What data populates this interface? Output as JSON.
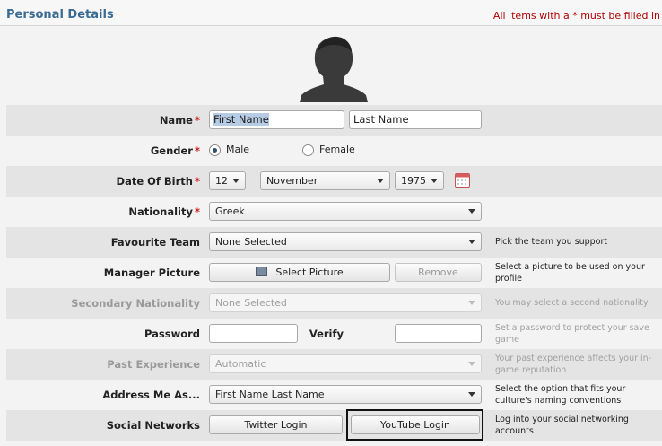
{
  "header": {
    "title": "Personal Details",
    "required_note": "All items with a * must be filled in",
    "required_marker": "*"
  },
  "fields": {
    "name": {
      "label": "Name",
      "first_value": "First Name",
      "last_value": "Last Name"
    },
    "gender": {
      "label": "Gender",
      "options": [
        "Male",
        "Female"
      ],
      "selected": "Male"
    },
    "dob": {
      "label": "Date Of Birth",
      "day": "12",
      "month": "November",
      "year": "1975"
    },
    "nationality": {
      "label": "Nationality",
      "value": "Greek"
    },
    "favourite_team": {
      "label": "Favourite Team",
      "value": "None Selected",
      "help": "Pick the team you support"
    },
    "manager_picture": {
      "label": "Manager Picture",
      "select_label": "Select Picture",
      "remove_label": "Remove",
      "help": "Select a picture to be used on your profile"
    },
    "secondary_nationality": {
      "label": "Secondary Nationality",
      "value": "None Selected",
      "help": "You may select a second nationality"
    },
    "password": {
      "label": "Password",
      "verify_label": "Verify",
      "value": "",
      "verify_value": "",
      "help": "Set a password to protect your save game"
    },
    "past_experience": {
      "label": "Past Experience",
      "value": "Automatic",
      "help": "Your past experience affects your in-game reputation"
    },
    "address_me_as": {
      "label": "Address Me As...",
      "value": "First Name Last Name",
      "help": "Select the option that fits your culture's naming conventions"
    },
    "social_networks": {
      "label": "Social Networks",
      "twitter_label": "Twitter Login",
      "youtube_label": "YouTube Login",
      "help": "Log into your social networking accounts"
    }
  },
  "colors": {
    "title": "#3a6b93",
    "required": "#cc1f1f",
    "row_shade": "#e4e4e4"
  },
  "icons": [
    "silhouette-avatar-icon",
    "calendar-icon",
    "picture-icon",
    "chevron-down-icon"
  ]
}
